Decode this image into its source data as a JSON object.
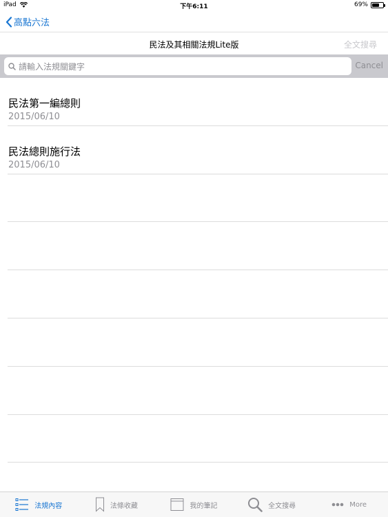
{
  "status": {
    "device": "iPad",
    "time": "下午6:11",
    "battery": "69%",
    "battery_level": 0.69
  },
  "back": {
    "label": "高點六法"
  },
  "nav": {
    "title": "民法及其相關法規Lite版",
    "fulltext": "全文搜尋"
  },
  "search": {
    "placeholder": "請輸入法規關鍵字",
    "cancel": "Cancel"
  },
  "laws": [
    {
      "title": "民法第一編總則",
      "date": "2015/06/10"
    },
    {
      "title": "民法總則施行法",
      "date": "2015/06/10"
    }
  ],
  "tabs": [
    {
      "label": "法規內容",
      "icon": "list-icon",
      "active": true
    },
    {
      "label": "法條收藏",
      "icon": "bookmark-icon",
      "active": false
    },
    {
      "label": "我的筆記",
      "icon": "notebook-icon",
      "active": false
    },
    {
      "label": "全文搜尋",
      "icon": "search-icon",
      "active": false
    },
    {
      "label": "More",
      "icon": "more-icon",
      "active": false
    }
  ],
  "colors": {
    "accent": "#1976d2",
    "inactive": "#8e8e93",
    "search_bg": "#c9c9ce"
  }
}
